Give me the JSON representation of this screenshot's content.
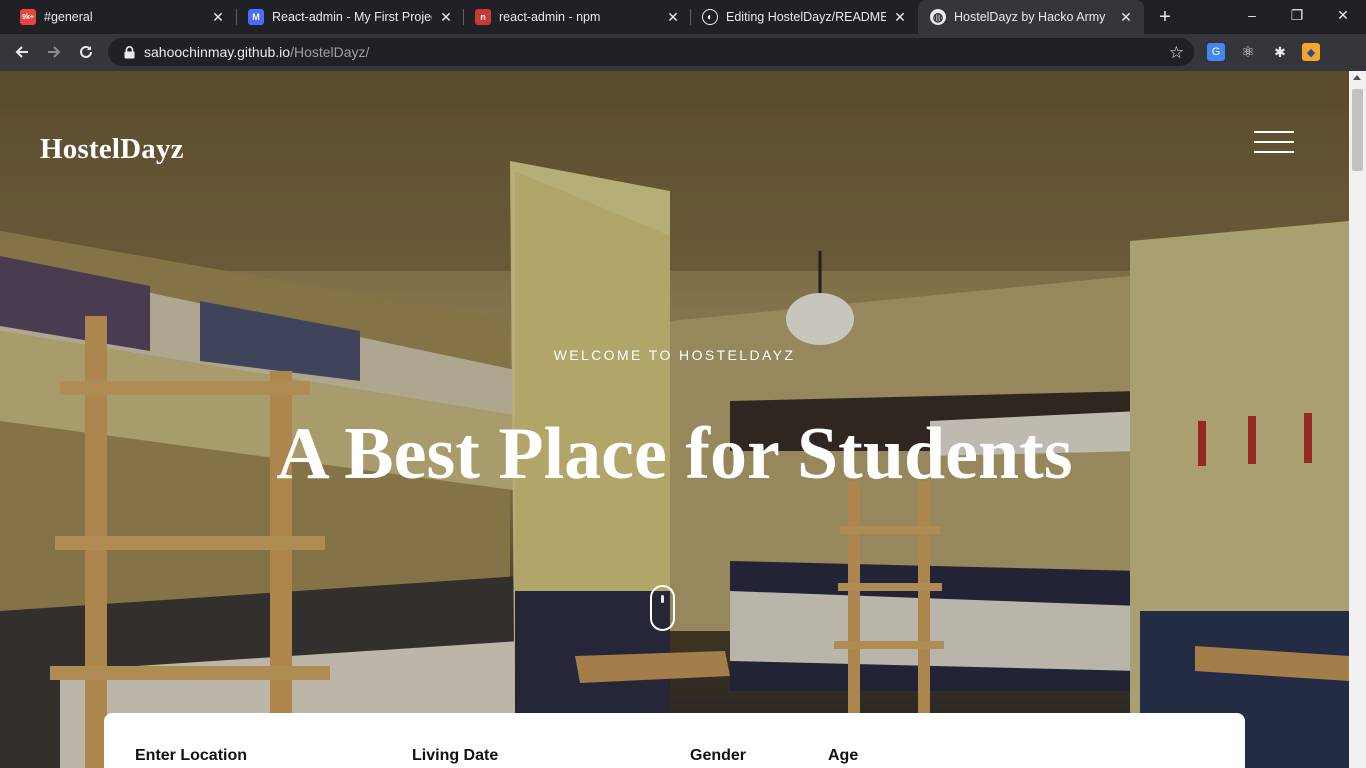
{
  "browser": {
    "tabs": [
      {
        "title": "#general",
        "favicon_text": "9k+",
        "favicon_color": "#e8453c",
        "active": false
      },
      {
        "title": "React-admin - My First Project",
        "favicon_text": "M",
        "favicon_color": "#4a6cf7",
        "active": false
      },
      {
        "title": "react-admin - npm",
        "favicon_text": "n",
        "favicon_color": "#cb3837",
        "active": false
      },
      {
        "title": "Editing HostelDayz/README.m",
        "favicon_text": "◐",
        "favicon_color": "#202124",
        "active": false
      },
      {
        "title": "HostelDayz by Hacko Army",
        "favicon_text": "◍",
        "favicon_color": "#35363a",
        "active": true
      }
    ],
    "new_tab_icon": "+",
    "window_controls": {
      "minimize": "–",
      "restore": "❐",
      "close": "✕"
    },
    "address": {
      "host": "sahoochinmay.github.io",
      "path": "/HostelDayz/"
    },
    "extensions": [
      {
        "name": "translate-icon",
        "glyph": "G",
        "color": "#4285f4"
      },
      {
        "name": "react-devtools-icon",
        "glyph": "⚛",
        "color": "#35363a"
      },
      {
        "name": "extensions-puzzle-icon",
        "glyph": "✱",
        "color": "#35363a"
      },
      {
        "name": "profile-avatar-icon",
        "glyph": "◆",
        "color": "#f4a62a"
      }
    ]
  },
  "page": {
    "brand": "HostelDayz",
    "welcome": "WELCOME TO HOSTELDAYZ",
    "headline": "A Best Place for Students",
    "search": {
      "location_label": "Enter Location",
      "date_label": "Living Date",
      "gender_label": "Gender",
      "age_label": "Age"
    }
  },
  "colors": {
    "chrome_dark": "#202124",
    "chrome_toolbar": "#35363a",
    "hero_text": "#ffffff",
    "card_bg": "#ffffff"
  }
}
